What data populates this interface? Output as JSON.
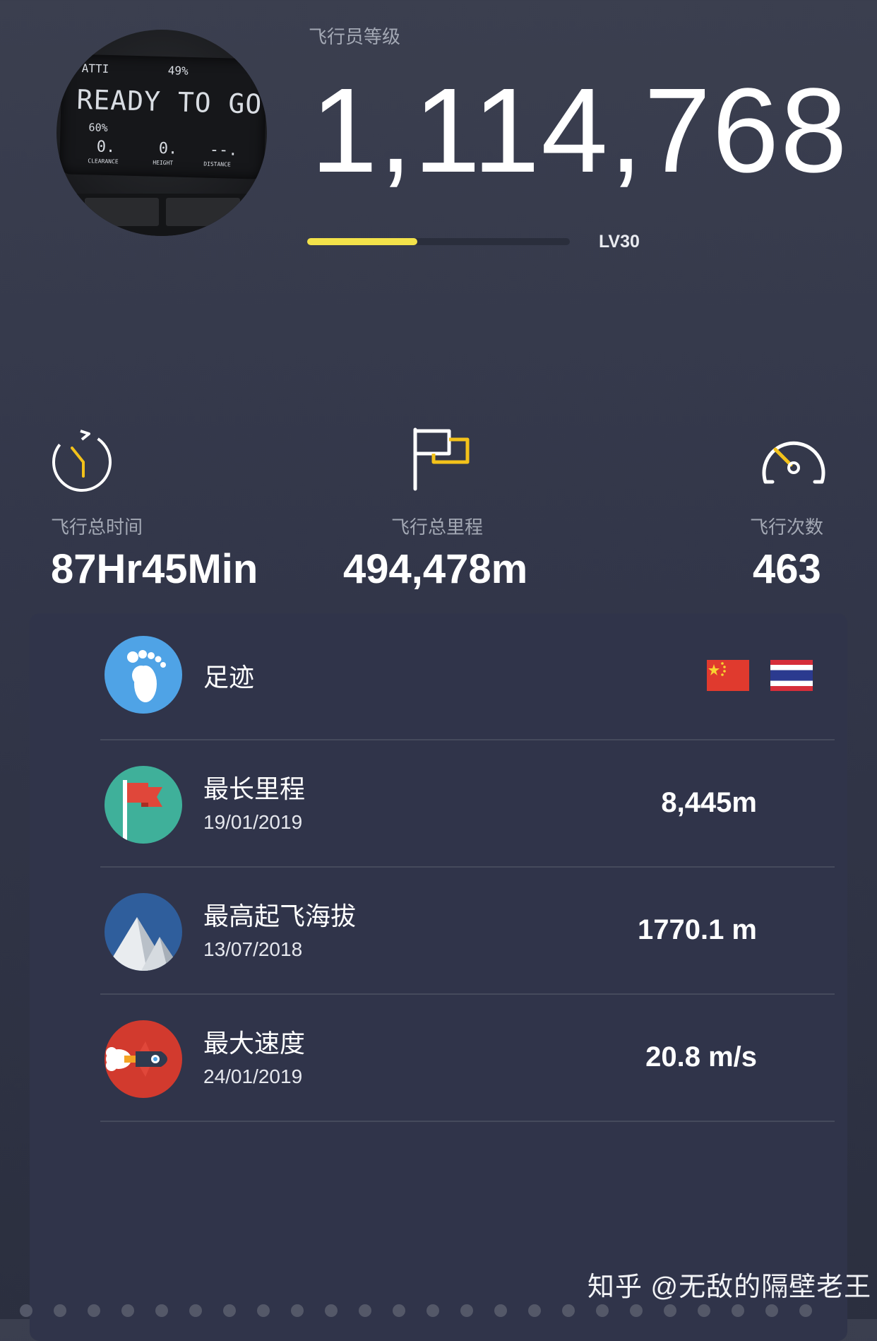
{
  "header": {
    "avatar": {
      "screen_lines": [
        "ATTI",
        "49%",
        "READY TO GO",
        "60%",
        "0.",
        "0.",
        "--.",
        "CLEARANCE",
        "HEIGHT",
        "DISTANCE"
      ]
    },
    "level_label": "飞行员等级",
    "score": "1,114,768",
    "level_progress_fraction": 0.42,
    "level_badge": "LV30",
    "progress_color": "#f3e24a"
  },
  "stats": [
    {
      "icon": "stopwatch-icon",
      "label": "飞行总时间",
      "value": "87Hr45Min"
    },
    {
      "icon": "flag-icon",
      "label": "飞行总里程",
      "value": "494,478m"
    },
    {
      "icon": "speedometer-icon",
      "label": "飞行次数",
      "value": "463"
    }
  ],
  "records": [
    {
      "icon": "footprint-icon",
      "title": "足迹",
      "flags": [
        "china-flag-icon",
        "thailand-flag-icon"
      ]
    },
    {
      "icon": "red-flag-icon",
      "title": "最长里程",
      "date": "19/01/2019",
      "value": "8,445m"
    },
    {
      "icon": "mountain-icon",
      "title": "最高起飞海拔",
      "date": "13/07/2018",
      "value": "1770.1 m"
    },
    {
      "icon": "rocket-icon",
      "title": "最大速度",
      "date": "24/01/2019",
      "value": "20.8 m/s"
    }
  ],
  "watermark": "知乎 @无敌的隔壁老王",
  "colors": {
    "background": "#3b3f4f",
    "panel": "#30344a",
    "accent": "#f3e24a",
    "footprint_bg": "#4fa3e6",
    "flag_bg": "#3fb09a",
    "mountain_bg": "#2f5e9c",
    "rocket_bg": "#d23a2e"
  }
}
